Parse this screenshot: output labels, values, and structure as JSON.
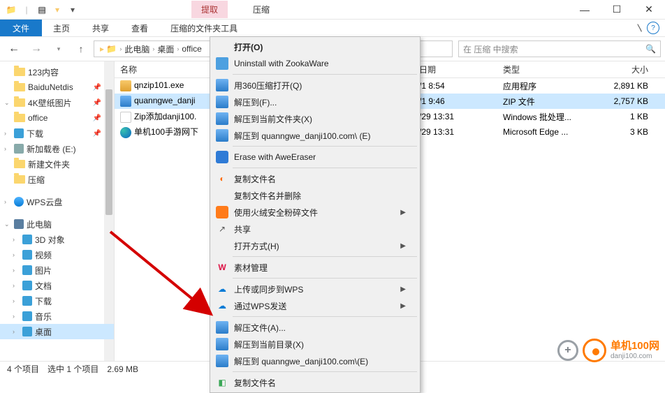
{
  "titlebar": {
    "tab_extract": "提取",
    "tab_compress": "压缩"
  },
  "ribbon": {
    "file": "文件",
    "home": "主页",
    "share": "共享",
    "view": "查看",
    "compress_tools": "压缩的文件夹工具"
  },
  "address": {
    "segments": [
      "此电脑",
      "桌面",
      "office"
    ],
    "search_placeholder": "在 压缩 中搜索"
  },
  "tree": [
    {
      "label": "123内容",
      "kind": "folder",
      "pin": false
    },
    {
      "label": "BaiduNetdis",
      "kind": "folder",
      "pin": true
    },
    {
      "label": "4K壁纸图片",
      "kind": "folder",
      "pin": true,
      "exp": "v"
    },
    {
      "label": "office",
      "kind": "folder",
      "pin": true
    },
    {
      "label": "下载",
      "kind": "dl",
      "pin": true,
      "exp": ">"
    },
    {
      "label": "新加载卷 (E:)",
      "kind": "drive",
      "pin": false,
      "exp": ">"
    },
    {
      "label": "新建文件夹",
      "kind": "folder",
      "pin": false
    },
    {
      "label": "压缩",
      "kind": "folder",
      "pin": false
    },
    {
      "gap": true
    },
    {
      "label": "WPS云盘",
      "kind": "wps",
      "exp": ">"
    },
    {
      "gap": true
    },
    {
      "label": "此电脑",
      "kind": "pc",
      "exp": "v"
    },
    {
      "label": "3D 对象",
      "kind": "obj",
      "indent": true,
      "exp": ">"
    },
    {
      "label": "视频",
      "kind": "obj",
      "indent": true,
      "exp": ">"
    },
    {
      "label": "图片",
      "kind": "obj",
      "indent": true,
      "exp": ">"
    },
    {
      "label": "文档",
      "kind": "obj",
      "indent": true,
      "exp": ">"
    },
    {
      "label": "下载",
      "kind": "obj",
      "indent": true,
      "exp": ">"
    },
    {
      "label": "音乐",
      "kind": "obj",
      "indent": true,
      "exp": ">"
    },
    {
      "label": "桌面",
      "kind": "obj",
      "indent": true,
      "exp": ">",
      "selected": true
    }
  ],
  "cols": {
    "name": "名称",
    "date": "日期",
    "type": "类型",
    "size": "大小"
  },
  "files": [
    {
      "name": "qnzip101.exe",
      "icon": "exe",
      "date": "/1 8:54",
      "type": "应用程序",
      "size": "2,891 KB"
    },
    {
      "name": "quanngwe_danji",
      "icon": "zip",
      "date": "/1 9:46",
      "type": "ZIP 文件",
      "size": "2,757 KB",
      "selected": true
    },
    {
      "name": "Zip添加danji100.",
      "icon": "bat",
      "date": "/29 13:31",
      "type": "Windows 批处理...",
      "size": "1 KB"
    },
    {
      "name": "单机100手游网下",
      "icon": "edge",
      "date": "/29 13:31",
      "type": "Microsoft Edge ...",
      "size": "3 KB"
    }
  ],
  "menu": [
    {
      "label": "打开(O)",
      "bold": true
    },
    {
      "label": "Uninstall with ZookaWare",
      "icon": "box"
    },
    {
      "sep": true
    },
    {
      "label": "用360压缩打开(Q)",
      "icon": "haozip"
    },
    {
      "label": "解压到(F)...",
      "icon": "haozip"
    },
    {
      "label": "解压到当前文件夹(X)",
      "icon": "haozip"
    },
    {
      "label": "解压到 quanngwe_danji100.com\\ (E)",
      "icon": "haozip"
    },
    {
      "sep": true
    },
    {
      "label": "Erase with AweEraser",
      "icon": "blue"
    },
    {
      "sep": true
    },
    {
      "label": "复制文件名",
      "icon": "orange-o"
    },
    {
      "label": "复制文件名并删除"
    },
    {
      "label": "使用火绒安全粉碎文件",
      "icon": "orange",
      "sub": true
    },
    {
      "label": "共享",
      "icon": "share"
    },
    {
      "label": "打开方式(H)",
      "sub": true
    },
    {
      "sep": true
    },
    {
      "label": "素材管理",
      "icon": "wps"
    },
    {
      "sep": true
    },
    {
      "label": "上传或同步到WPS",
      "icon": "wps-cloud",
      "sub": true
    },
    {
      "label": "通过WPS发送",
      "icon": "wps-cloud",
      "sub": true
    },
    {
      "sep": true
    },
    {
      "label": "解压文件(A)...",
      "icon": "haozip"
    },
    {
      "label": "解压到当前目录(X)",
      "icon": "haozip"
    },
    {
      "label": "解压到 quanngwe_danji100.com\\(E)",
      "icon": "haozip"
    },
    {
      "sep": true
    },
    {
      "label": "复制文件名",
      "icon": "green-dot"
    }
  ],
  "status": {
    "count": "4 个项目",
    "selection": "选中 1 个项目",
    "size": "2.69 MB"
  },
  "watermark": {
    "zh": "单机100网",
    "en": "danji100.com"
  }
}
